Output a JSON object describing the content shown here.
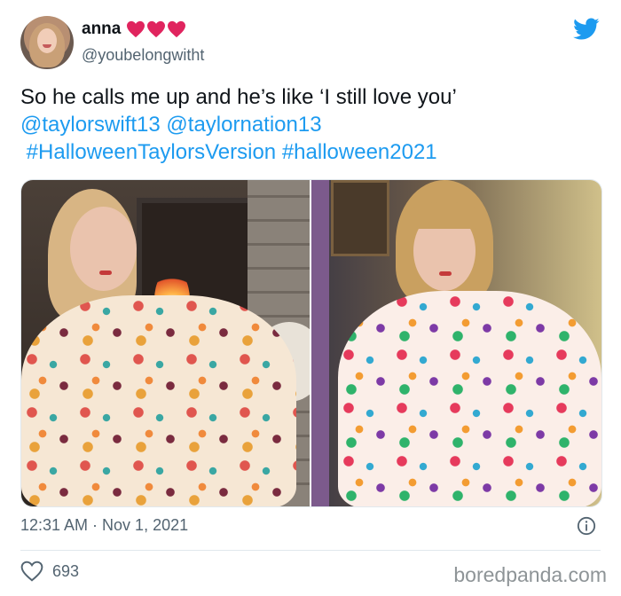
{
  "tweet": {
    "author": {
      "display_name": "anna",
      "handle": "@youbelongwitht",
      "name_emoji": [
        "heart-icon",
        "heart-icon",
        "heart-icon"
      ]
    },
    "text": {
      "line1": "So he calls me up and he’s like ‘I still love you’",
      "mention1": "@taylorswift13",
      "mention2": "@taylornation13",
      "hashtag1": "#HalloweenTaylorsVersion",
      "hashtag2": "#halloween2021"
    },
    "timestamp": "12:31 AM · Nov 1, 2021",
    "like_count": "693"
  },
  "watermark": "boredpanda.com",
  "colors": {
    "link": "#1d9bf0",
    "heart": "#e0245e",
    "twitter_blue": "#1d9bf0",
    "secondary_text": "#536471"
  },
  "icons": {
    "brand": "twitter-bird-icon",
    "info": "info-icon",
    "like": "heart-outline-icon"
  }
}
